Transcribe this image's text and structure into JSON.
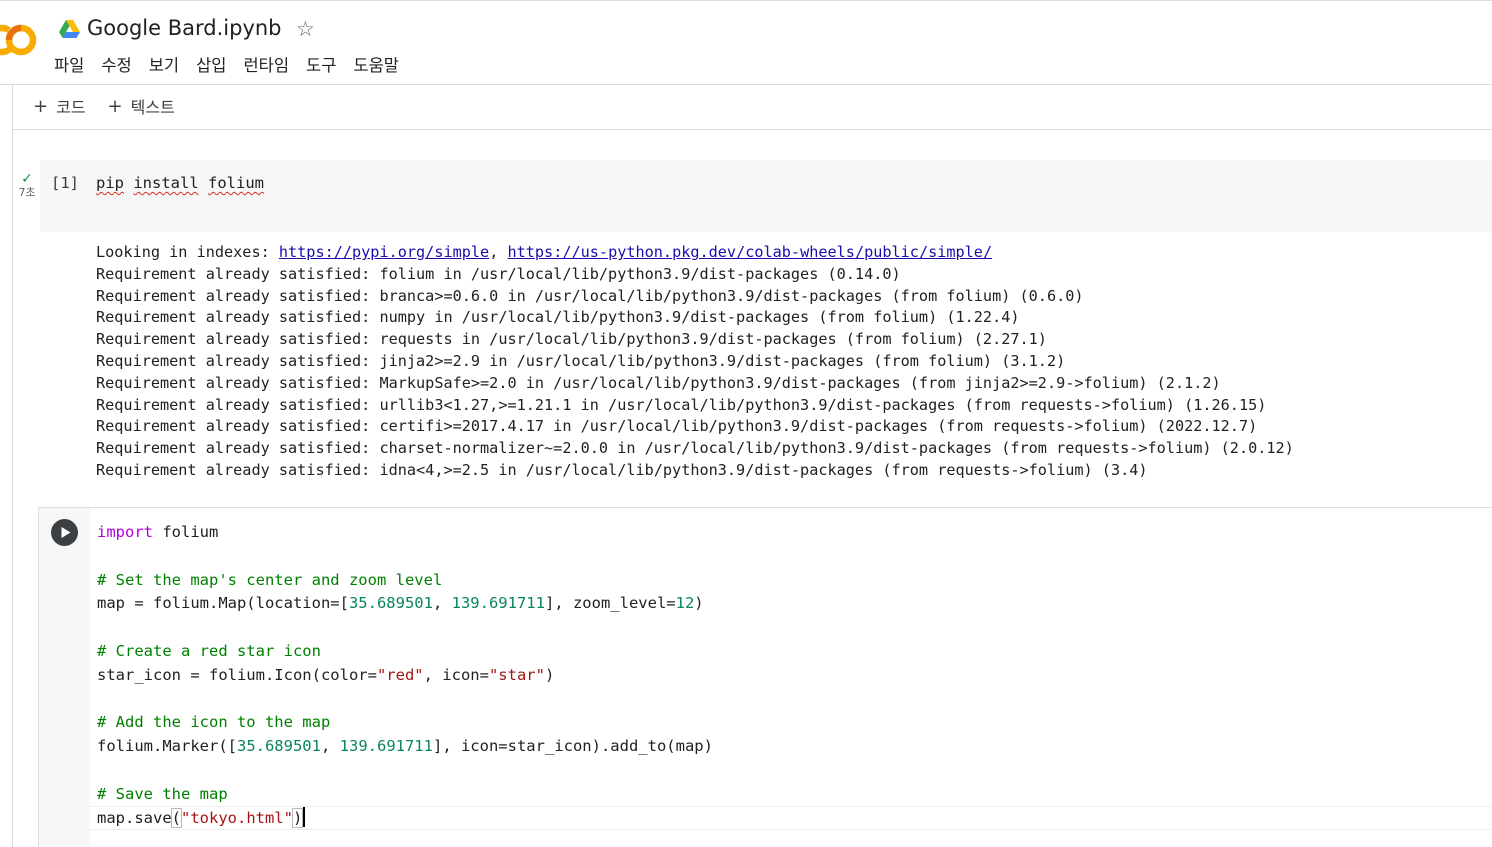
{
  "header": {
    "logo_text": "CO",
    "title": "Google Bard.ipynb",
    "star_glyph": "☆",
    "menu": [
      "파일",
      "수정",
      "보기",
      "삽입",
      "런타임",
      "도구",
      "도움말"
    ]
  },
  "toolbar": {
    "add_code_label": "코드",
    "add_text_label": "텍스트",
    "plus_glyph": "+"
  },
  "cell1": {
    "execution_count": "[1]",
    "exec_time": "7초",
    "code_words": [
      "pip",
      "install",
      "folium"
    ],
    "output": {
      "index_prefix": "Looking in indexes: ",
      "index_link_1": "https://pypi.org/simple",
      "index_sep": ", ",
      "index_link_2": "https://us-python.pkg.dev/colab-wheels/public/simple/",
      "lines": [
        "Requirement already satisfied: folium in /usr/local/lib/python3.9/dist-packages (0.14.0)",
        "Requirement already satisfied: branca>=0.6.0 in /usr/local/lib/python3.9/dist-packages (from folium) (0.6.0)",
        "Requirement already satisfied: numpy in /usr/local/lib/python3.9/dist-packages (from folium) (1.22.4)",
        "Requirement already satisfied: requests in /usr/local/lib/python3.9/dist-packages (from folium) (2.27.1)",
        "Requirement already satisfied: jinja2>=2.9 in /usr/local/lib/python3.9/dist-packages (from folium) (3.1.2)",
        "Requirement already satisfied: MarkupSafe>=2.0 in /usr/local/lib/python3.9/dist-packages (from jinja2>=2.9->folium) (2.1.2)",
        "Requirement already satisfied: urllib3<1.27,>=1.21.1 in /usr/local/lib/python3.9/dist-packages (from requests->folium) (1.26.15)",
        "Requirement already satisfied: certifi>=2017.4.17 in /usr/local/lib/python3.9/dist-packages (from requests->folium) (2022.12.7)",
        "Requirement already satisfied: charset-normalizer~=2.0.0 in /usr/local/lib/python3.9/dist-packages (from requests->folium) (2.0.12)",
        "Requirement already satisfied: idna<4,>=2.5 in /usr/local/lib/python3.9/dist-packages (from requests->folium) (3.4)"
      ]
    }
  },
  "cell2": {
    "code": {
      "import_kw": "import",
      "import_mod": " folium",
      "comment_1": "# Set the map's center and zoom level",
      "map_prefix": "map = folium.Map(location=[",
      "lat": "35.689501",
      "comma": ", ",
      "lon": "139.691711",
      "map_mid": "], zoom_level=",
      "zoom": "12",
      "map_end": ")",
      "comment_2": "# Create a red star icon",
      "icon_prefix": "star_icon = folium.Icon(color=",
      "color_str": "\"red\"",
      "icon_mid": ", icon=",
      "icon_str": "\"star\"",
      "icon_end": ")",
      "comment_3": "# Add the icon to the map",
      "marker_prefix": "folium.Marker([",
      "marker_end": "], icon=star_icon).add_to(map)",
      "comment_4": "# Save the map",
      "save_prefix": "map.save",
      "save_open": "(",
      "save_str": "\"tokyo.html\"",
      "save_close": ")"
    }
  },
  "icons": {
    "drive": "google-drive-icon",
    "star": "star-outline-icon",
    "check": "check-icon",
    "run": "play-circle-icon"
  },
  "colors": {
    "logo_orange": "#F9AB00",
    "keyword": "#af00db",
    "comment": "#008000",
    "number": "#098658",
    "string": "#a31515",
    "link": "#1a0dab",
    "check_green": "#1e8e3e"
  }
}
